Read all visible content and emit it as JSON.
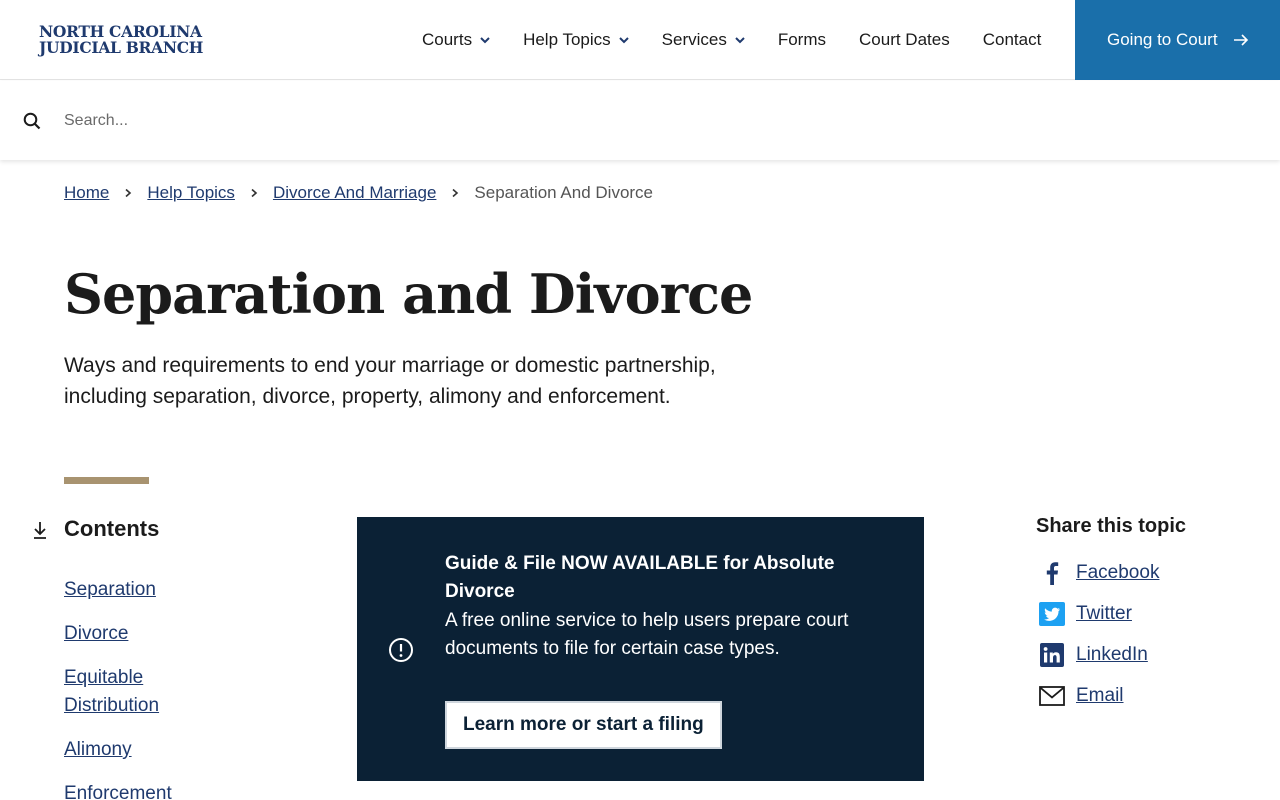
{
  "header": {
    "logo_line1": "NORTH CAROLINA",
    "logo_line2": "JUDICIAL BRANCH",
    "nav": [
      {
        "label": "Courts",
        "has_dropdown": true
      },
      {
        "label": "Help Topics",
        "has_dropdown": true
      },
      {
        "label": "Services",
        "has_dropdown": true
      },
      {
        "label": "Forms",
        "has_dropdown": false
      },
      {
        "label": "Court Dates",
        "has_dropdown": false
      },
      {
        "label": "Contact",
        "has_dropdown": false
      }
    ],
    "cta_label": "Going to Court",
    "cta_color": "#1a6faa"
  },
  "search": {
    "placeholder": "Search...",
    "value": ""
  },
  "breadcrumb": {
    "items": [
      "Home",
      "Help Topics",
      "Divorce And Marriage"
    ],
    "current": "Separation And Divorce"
  },
  "page": {
    "title": "Separation and Divorce",
    "subtitle": "Ways and requirements to end your marriage or domestic partnership, including separation, divorce, property, alimony and enforcement."
  },
  "contents": {
    "title": "Contents",
    "items": [
      "Separation",
      "Divorce",
      "Equitable Distribution",
      "Alimony",
      "Enforcement"
    ]
  },
  "alert": {
    "title": "Guide & File NOW AVAILABLE for Absolute Divorce",
    "body": "A free online service to help users prepare court documents to file for certain case types.",
    "button_label": "Learn more or start a filing",
    "background": "#0b2135"
  },
  "share": {
    "title": "Share this topic",
    "items": [
      {
        "label": "Facebook",
        "icon": "facebook-icon"
      },
      {
        "label": "Twitter",
        "icon": "twitter-icon"
      },
      {
        "label": "LinkedIn",
        "icon": "linkedin-icon"
      },
      {
        "label": "Email",
        "icon": "email-icon"
      }
    ]
  },
  "colors": {
    "link": "#1f3a6e",
    "accent_bar": "#a89370"
  }
}
